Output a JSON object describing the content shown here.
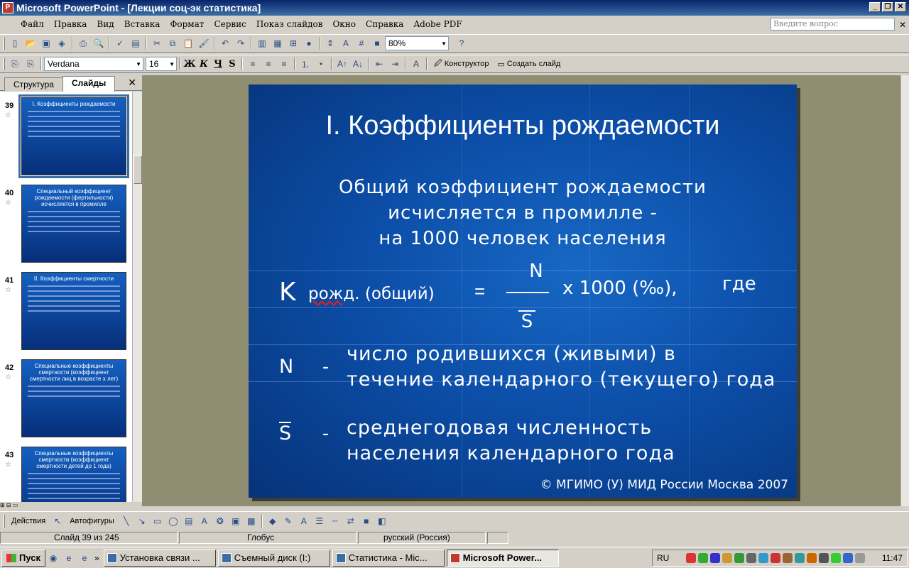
{
  "window": {
    "title": "Microsoft PowerPoint - [Лекции соц-эк статистика]"
  },
  "menu": [
    "Файл",
    "Правка",
    "Вид",
    "Вставка",
    "Формат",
    "Сервис",
    "Показ слайдов",
    "Окно",
    "Справка",
    "Adobe PDF"
  ],
  "ask_placeholder": "Введите вопрос",
  "toolbar": {
    "zoom": "80%",
    "font": "Verdana",
    "size": "16",
    "designer": "Конструктор",
    "new_slide": "Создать слайд"
  },
  "pane": {
    "tab_outline": "Структура",
    "tab_slides": "Слайды",
    "thumbs": [
      {
        "num": "39",
        "title": "I. Коэффициенты рождаемости"
      },
      {
        "num": "40",
        "title": "Специальный коэффициент рождаемости (фертильности) исчисляется в промилле"
      },
      {
        "num": "41",
        "title": "II. Коэффициенты смертности"
      },
      {
        "num": "42",
        "title": "Специальные коэффициенты смертности (коэффициент смертности лиц в возрасте x лет)"
      },
      {
        "num": "43",
        "title": "Специальные коэффициенты смертности (коэффициент смертности детей до 1 года)"
      }
    ]
  },
  "slide": {
    "title": "I. Коэффициенты рождаемости",
    "sub1": "Общий коэффициент рождаемости",
    "sub2": "исчисляется в промилле -",
    "sub3": "на 1000 человек населения",
    "k": "K",
    "k_sub1": "рожд",
    "k_sub2": ". (общий)",
    "eq": "=",
    "num": "N",
    "den": "S",
    "times": "x 1000 (‰),",
    "where": "где",
    "n_sym": "N",
    "n_dash": "-",
    "n_def1": "число родившихся (живыми) в",
    "n_def2": "течение календарного (текущего) года",
    "s_sym": "S",
    "s_dash": "-",
    "s_def1": "среднегодовая численность",
    "s_def2": "населения календарного года",
    "copyright": "© МГИМО (У) МИД России Москва 2007"
  },
  "drawbar": {
    "actions": "Действия",
    "autoshapes": "Автофигуры"
  },
  "status": {
    "slide": "Слайд 39 из 245",
    "design": "Глобус",
    "lang": "русский (Россия)"
  },
  "taskbar": {
    "start": "Пуск",
    "tasks": [
      "Установка связи ...",
      "Съемный диск (I:)",
      "Статистика - Mic...",
      "Microsoft Power..."
    ],
    "lang": "RU",
    "time": "11:47"
  },
  "colors": {
    "slide_bg": "#0c4ea8",
    "titlebar": "#0a246a",
    "editor_bg": "#8f8e73"
  }
}
